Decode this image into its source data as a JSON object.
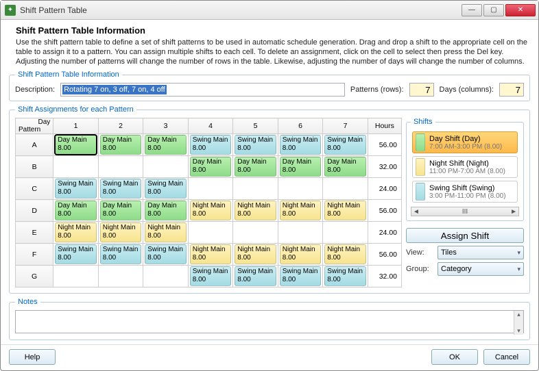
{
  "window": {
    "title": "Shift Pattern Table"
  },
  "header": {
    "title": "Shift Pattern Table Information",
    "instructions": "Use the shift pattern table to define a set of shift patterns to be used in automatic schedule generation. Drag and drop a shift to the appropriate cell on the table to assign it to a pattern. You can assign multiple shifts to each cell. To delete an assignment, click on the cell to select then press the Del key.  Adjusting the number of patterns will change the number of rows in the table. Likewise, adjusting the number of days will change the number of columns."
  },
  "info": {
    "legend": "Shift Pattern Table Information",
    "description_label": "Description:",
    "description_value": "Rotating 7 on, 3 off, 7 on, 4 off",
    "patterns_label": "Patterns (rows):",
    "patterns_value": "7",
    "days_label": "Days (columns):",
    "days_value": "7"
  },
  "assignments": {
    "legend": "Shift Assignments for each Pattern",
    "corner_top": "Day",
    "corner_left": "Pattern",
    "day_headers": [
      "1",
      "2",
      "3",
      "4",
      "5",
      "6",
      "7"
    ],
    "hours_header": "Hours",
    "rows": [
      {
        "pattern": "A",
        "hours": "56.00",
        "cells": [
          {
            "t": "day",
            "l": "Day Main",
            "h": "8.00",
            "sel": true
          },
          {
            "t": "day",
            "l": "Day Main",
            "h": "8.00"
          },
          {
            "t": "day",
            "l": "Day Main",
            "h": "8.00"
          },
          {
            "t": "swing",
            "l": "Swing Main",
            "h": "8.00"
          },
          {
            "t": "swing",
            "l": "Swing Main",
            "h": "8.00"
          },
          {
            "t": "swing",
            "l": "Swing Main",
            "h": "8.00"
          },
          {
            "t": "swing",
            "l": "Swing Main",
            "h": "8.00"
          }
        ]
      },
      {
        "pattern": "B",
        "hours": "32.00",
        "cells": [
          null,
          null,
          null,
          {
            "t": "day",
            "l": "Day Main",
            "h": "8.00"
          },
          {
            "t": "day",
            "l": "Day Main",
            "h": "8.00"
          },
          {
            "t": "day",
            "l": "Day Main",
            "h": "8.00"
          },
          {
            "t": "day",
            "l": "Day Main",
            "h": "8.00"
          }
        ]
      },
      {
        "pattern": "C",
        "hours": "24.00",
        "cells": [
          {
            "t": "swing",
            "l": "Swing Main",
            "h": "8.00"
          },
          {
            "t": "swing",
            "l": "Swing Main",
            "h": "8.00"
          },
          {
            "t": "swing",
            "l": "Swing Main",
            "h": "8.00"
          },
          null,
          null,
          null,
          null
        ]
      },
      {
        "pattern": "D",
        "hours": "56.00",
        "cells": [
          {
            "t": "day",
            "l": "Day Main",
            "h": "8.00"
          },
          {
            "t": "day",
            "l": "Day Main",
            "h": "8.00"
          },
          {
            "t": "day",
            "l": "Day Main",
            "h": "8.00"
          },
          {
            "t": "night",
            "l": "Night Main",
            "h": "8.00"
          },
          {
            "t": "night",
            "l": "Night Main",
            "h": "8.00"
          },
          {
            "t": "night",
            "l": "Night Main",
            "h": "8.00"
          },
          {
            "t": "night",
            "l": "Night Main",
            "h": "8.00"
          }
        ]
      },
      {
        "pattern": "E",
        "hours": "24.00",
        "cells": [
          {
            "t": "night",
            "l": "Night Main",
            "h": "8.00"
          },
          {
            "t": "night",
            "l": "Night Main",
            "h": "8.00"
          },
          {
            "t": "night",
            "l": "Night Main",
            "h": "8.00"
          },
          null,
          null,
          null,
          null
        ]
      },
      {
        "pattern": "F",
        "hours": "56.00",
        "cells": [
          {
            "t": "swing",
            "l": "Swing Main",
            "h": "8.00"
          },
          {
            "t": "swing",
            "l": "Swing Main",
            "h": "8.00"
          },
          {
            "t": "swing",
            "l": "Swing Main",
            "h": "8.00"
          },
          {
            "t": "night",
            "l": "Night Main",
            "h": "8.00"
          },
          {
            "t": "night",
            "l": "Night Main",
            "h": "8.00"
          },
          {
            "t": "night",
            "l": "Night Main",
            "h": "8.00"
          },
          {
            "t": "night",
            "l": "Night Main",
            "h": "8.00"
          }
        ]
      },
      {
        "pattern": "G",
        "hours": "32.00",
        "cells": [
          null,
          null,
          null,
          {
            "t": "swing",
            "l": "Swing Main",
            "h": "8.00"
          },
          {
            "t": "swing",
            "l": "Swing Main",
            "h": "8.00"
          },
          {
            "t": "swing",
            "l": "Swing Main",
            "h": "8.00"
          },
          {
            "t": "swing",
            "l": "Swing Main",
            "h": "8.00"
          }
        ]
      }
    ]
  },
  "shifts": {
    "legend": "Shifts",
    "items": [
      {
        "name": "Day Shift (Day)",
        "sub": "7:00 AM-3:00 PM (8.00)",
        "type": "day",
        "selected": true
      },
      {
        "name": "Night Shift (Night)",
        "sub": "11:00 PM-7:00 AM (8.00)",
        "type": "night"
      },
      {
        "name": "Swing Shift (Swing)",
        "sub": "3:00 PM-11:00 PM (8.00)",
        "type": "swing"
      }
    ],
    "assign_label": "Assign Shift",
    "view_label": "View:",
    "view_value": "Tiles",
    "group_label": "Group:",
    "group_value": "Category",
    "scroll_marker": "III"
  },
  "notes": {
    "legend": "Notes",
    "value": ""
  },
  "buttons": {
    "help": "Help",
    "ok": "OK",
    "cancel": "Cancel"
  },
  "colors": {
    "day": "#8edc8a",
    "night": "#f7e48f",
    "swing": "#a4dbe4"
  }
}
